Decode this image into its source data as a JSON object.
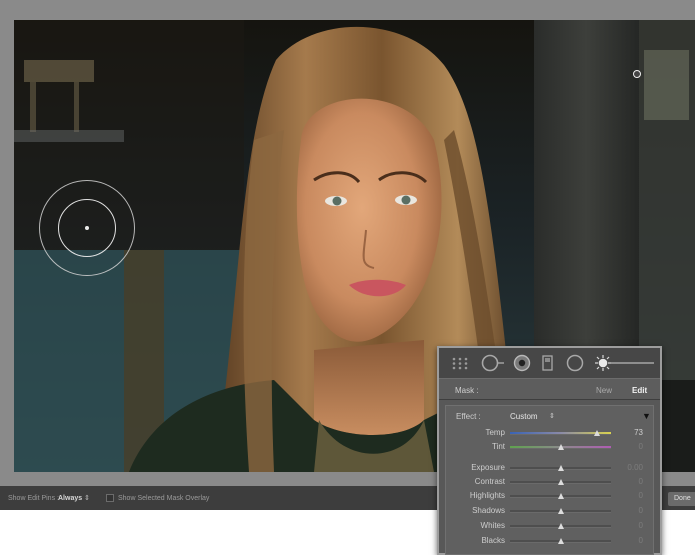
{
  "canvas": {
    "edit_pin_icon": "edit-pin",
    "brush_cursor_icon": "brush-cursor"
  },
  "toolbar": {
    "show_edit_pins_label": "Show Edit Pins :",
    "show_edit_pins_value": "Always",
    "show_mask_overlay_label": "Show Selected Mask Overlay",
    "show_mask_overlay_checked": false,
    "done_label": "Done"
  },
  "panel": {
    "tools": [
      "grid-tool-icon",
      "crop-tool-icon",
      "spot-removal-icon",
      "redeye-icon",
      "graduated-filter-icon",
      "radial-filter-icon",
      "adjustment-brush-icon"
    ],
    "mask_label": "Mask :",
    "new_label": "New",
    "edit_label": "Edit",
    "effect_label": "Effect :",
    "effect_preset": "Custom",
    "sliders": [
      {
        "label": "Temp",
        "value": "73",
        "position": 0.86,
        "style": "temp"
      },
      {
        "label": "Tint",
        "value": "0",
        "position": 0.5,
        "style": "tint"
      },
      {
        "label": "Exposure",
        "value": "0.00",
        "position": 0.5,
        "style": "plain"
      },
      {
        "label": "Contrast",
        "value": "0",
        "position": 0.5,
        "style": "plain"
      },
      {
        "label": "Highlights",
        "value": "0",
        "position": 0.5,
        "style": "plain"
      },
      {
        "label": "Shadows",
        "value": "0",
        "position": 0.5,
        "style": "plain"
      },
      {
        "label": "Whites",
        "value": "0",
        "position": 0.5,
        "style": "plain"
      },
      {
        "label": "Blacks",
        "value": "0",
        "position": 0.5,
        "style": "plain"
      }
    ]
  },
  "colors": {
    "panel_bg": "#585858",
    "toolbar_bg": "#3d3d3d",
    "frame_bg": "#8a8a8a"
  }
}
